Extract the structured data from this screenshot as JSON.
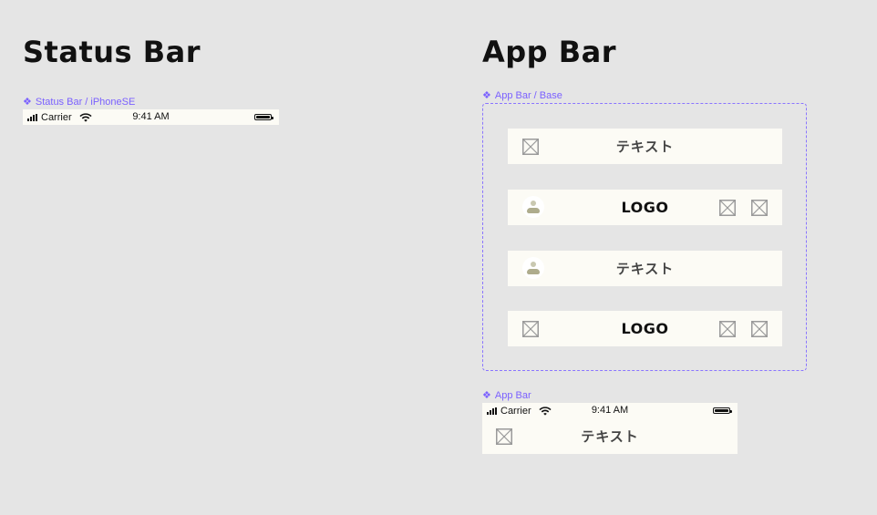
{
  "status_bar_section": {
    "title": "Status Bar",
    "component_label": "Status Bar / iPhoneSE",
    "status_bar": {
      "carrier": "Carrier",
      "time": "9:41 AM",
      "signal_icon": "cellular-signal-icon",
      "wifi_icon": "wifi-icon",
      "battery_icon": "battery-icon"
    }
  },
  "app_bar_section": {
    "title": "App Bar",
    "base_label": "App Bar / Base",
    "variants": [
      {
        "leading": "placeholder-image-icon",
        "title": "テキスト",
        "trailing": []
      },
      {
        "leading": "avatar-icon",
        "title": "LOGO",
        "trailing": [
          "placeholder-image-icon",
          "placeholder-image-icon"
        ]
      },
      {
        "leading": "avatar-icon",
        "title": "テキスト",
        "trailing": []
      },
      {
        "leading": "placeholder-image-icon",
        "title": "LOGO",
        "trailing": [
          "placeholder-image-icon",
          "placeholder-image-icon"
        ]
      }
    ],
    "composite_label": "App Bar",
    "composite": {
      "carrier": "Carrier",
      "time": "9:41 AM",
      "title": "テキスト",
      "leading": "placeholder-image-icon"
    }
  },
  "colors": {
    "background": "#e5e5e5",
    "surface": "#fcfbf5",
    "component_accent": "#7b61ff"
  }
}
